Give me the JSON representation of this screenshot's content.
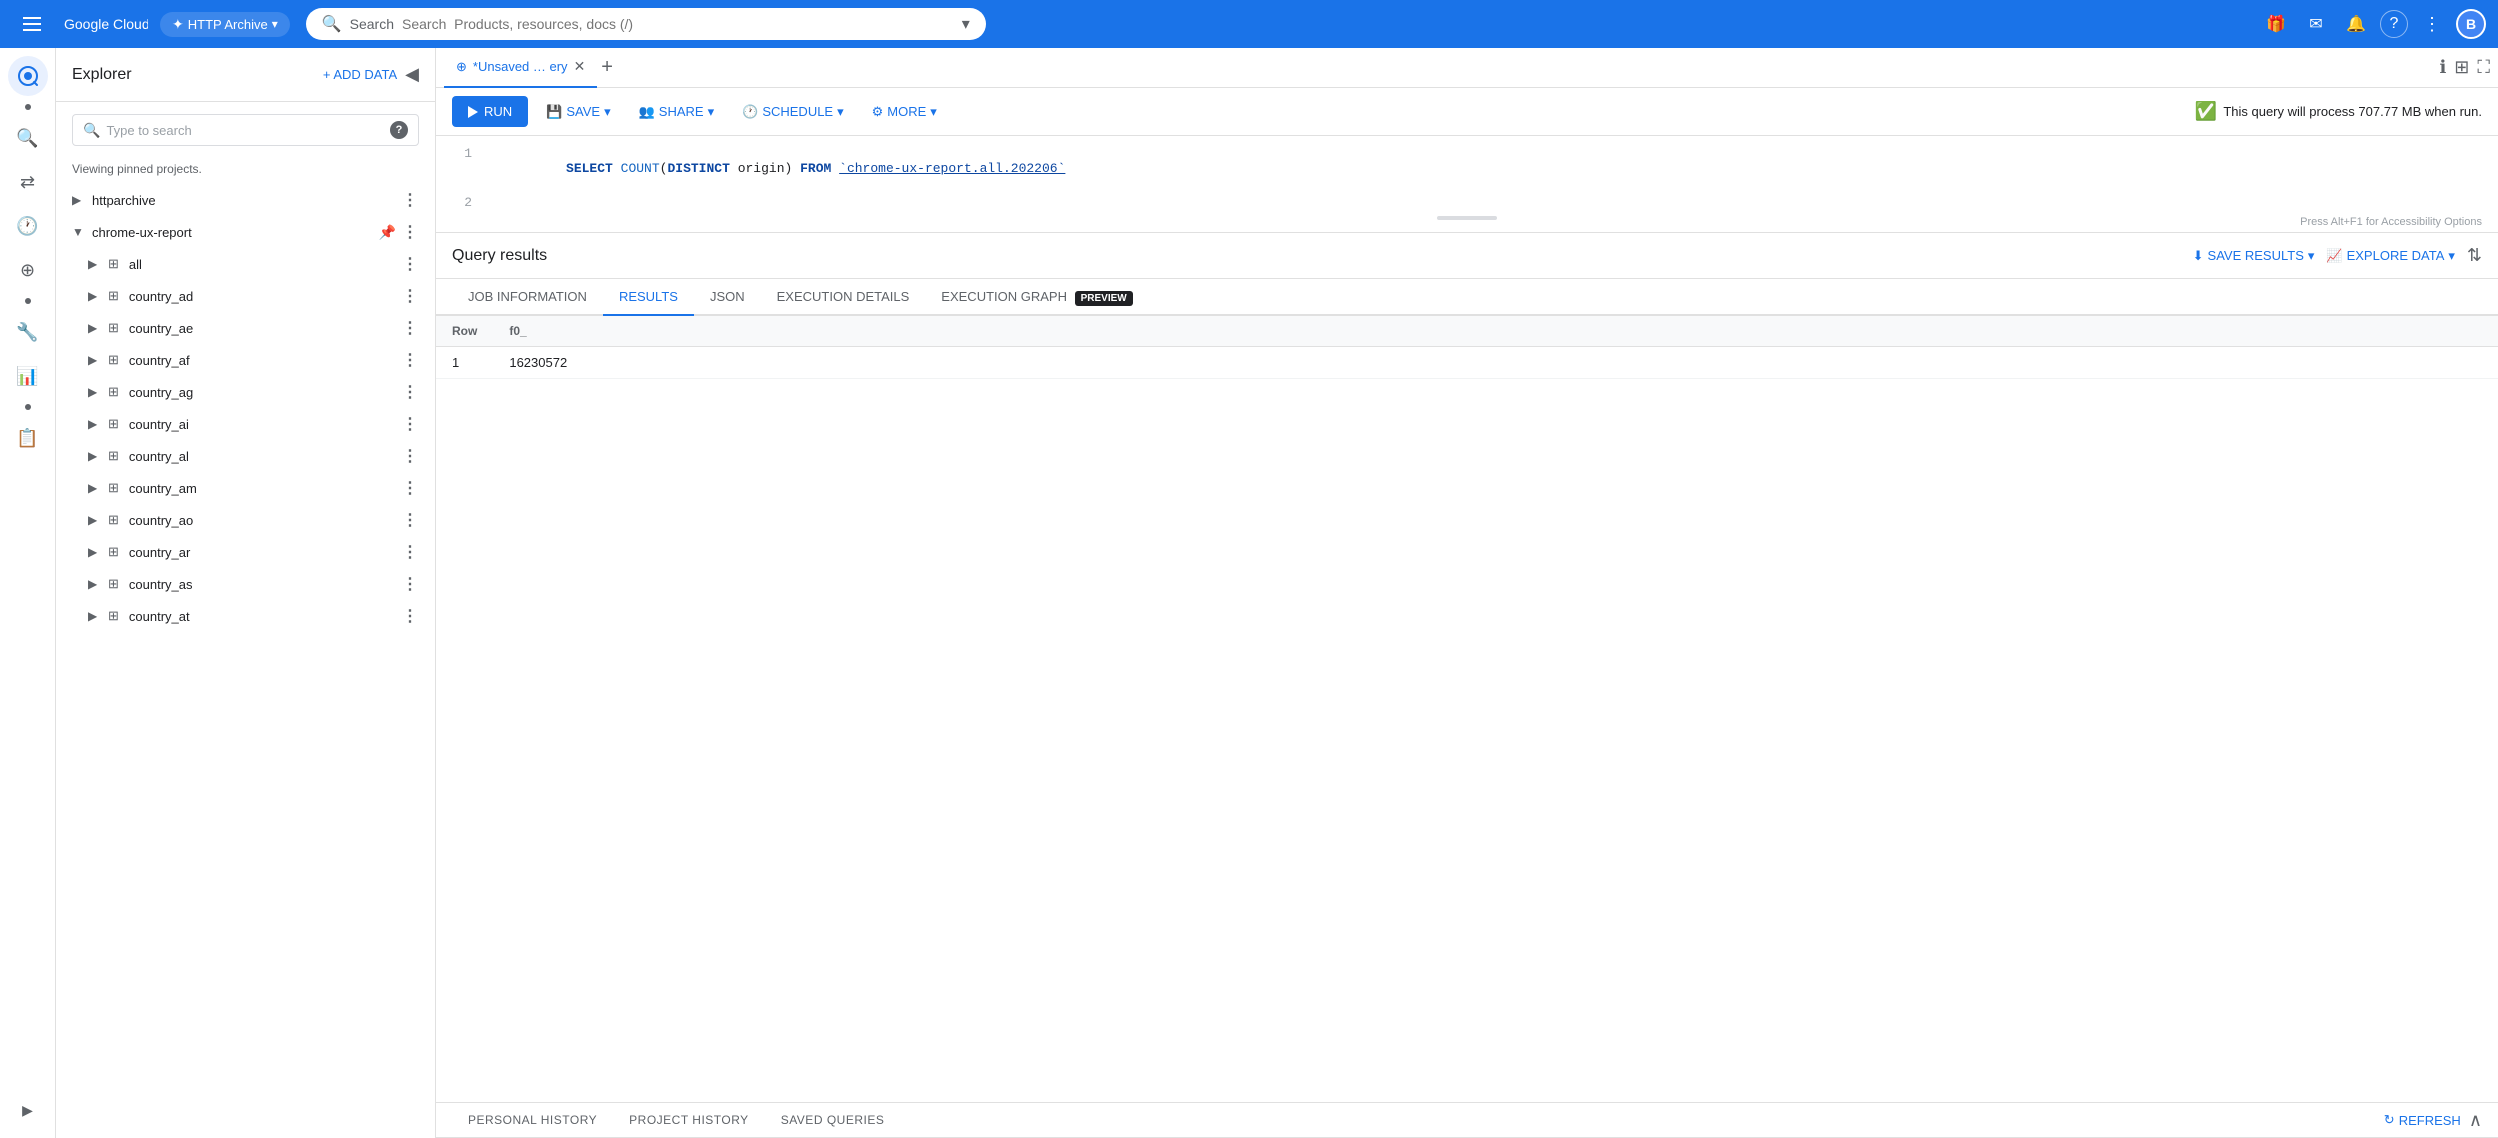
{
  "topbar": {
    "menu_icon": "☰",
    "logo_text": "Google Cloud",
    "project_name": "HTTP Archive",
    "search_placeholder": "Search  Products, resources, docs (/)",
    "gifts_icon": "🎁",
    "email_icon": "✉",
    "bell_icon": "🔔",
    "help_icon": "?",
    "more_icon": "⋮",
    "avatar_text": "B"
  },
  "explorer": {
    "title": "Explorer",
    "add_data_label": "+ ADD DATA",
    "collapse_icon": "◀",
    "search_placeholder": "Type to search",
    "pinned_label": "Viewing pinned projects.",
    "tree": [
      {
        "id": "httparchive",
        "label": "httparchive",
        "expanded": false,
        "pinned": false,
        "level": 0
      },
      {
        "id": "chrome-ux-report",
        "label": "chrome-ux-report",
        "expanded": true,
        "pinned": true,
        "level": 0
      },
      {
        "id": "all",
        "label": "all",
        "expanded": false,
        "pinned": false,
        "level": 1
      },
      {
        "id": "country_ad",
        "label": "country_ad",
        "expanded": false,
        "pinned": false,
        "level": 1
      },
      {
        "id": "country_ae",
        "label": "country_ae",
        "expanded": false,
        "pinned": false,
        "level": 1
      },
      {
        "id": "country_af",
        "label": "country_af",
        "expanded": false,
        "pinned": false,
        "level": 1
      },
      {
        "id": "country_ag",
        "label": "country_ag",
        "expanded": false,
        "pinned": false,
        "level": 1
      },
      {
        "id": "country_ai",
        "label": "country_ai",
        "expanded": false,
        "pinned": false,
        "level": 1
      },
      {
        "id": "country_al",
        "label": "country_al",
        "expanded": false,
        "pinned": false,
        "level": 1
      },
      {
        "id": "country_am",
        "label": "country_am",
        "expanded": false,
        "pinned": false,
        "level": 1
      },
      {
        "id": "country_ao",
        "label": "country_ao",
        "expanded": false,
        "pinned": false,
        "level": 1
      },
      {
        "id": "country_ar",
        "label": "country_ar",
        "expanded": false,
        "pinned": false,
        "level": 1
      },
      {
        "id": "country_as",
        "label": "country_as",
        "expanded": false,
        "pinned": false,
        "level": 1
      },
      {
        "id": "country_at",
        "label": "country_at",
        "expanded": false,
        "pinned": false,
        "level": 1
      }
    ]
  },
  "query_tab": {
    "label": "*Unsaved … ery",
    "close_icon": "✕",
    "add_icon": "+"
  },
  "toolbar": {
    "run_label": "RUN",
    "save_label": "SAVE",
    "share_label": "SHARE",
    "schedule_label": "SCHEDULE",
    "more_label": "MORE",
    "query_info": "This query will process 707.77 MB when run."
  },
  "editor": {
    "line1": "SELECT COUNT(DISTINCT origin) FROM `chrome-ux-report.all.202206`",
    "line2": "",
    "hint": "Press Alt+F1 for Accessibility Options"
  },
  "results": {
    "title": "Query results",
    "save_results_label": "SAVE RESULTS",
    "explore_data_label": "EXPLORE DATA",
    "tabs": [
      {
        "id": "job-info",
        "label": "JOB INFORMATION",
        "active": false
      },
      {
        "id": "results",
        "label": "RESULTS",
        "active": true
      },
      {
        "id": "json",
        "label": "JSON",
        "active": false
      },
      {
        "id": "execution-details",
        "label": "EXECUTION DETAILS",
        "active": false
      },
      {
        "id": "execution-graph",
        "label": "EXECUTION GRAPH",
        "active": false,
        "badge": "PREVIEW"
      }
    ],
    "table": {
      "columns": [
        "Row",
        "f0_"
      ],
      "rows": [
        {
          "row": "1",
          "f0_": "16230572"
        }
      ]
    }
  },
  "bottom_panel": {
    "tabs": [
      {
        "id": "personal-history",
        "label": "PERSONAL HISTORY"
      },
      {
        "id": "project-history",
        "label": "PROJECT HISTORY"
      },
      {
        "id": "saved-queries",
        "label": "SAVED QUERIES"
      }
    ],
    "refresh_label": "REFRESH",
    "collapse_icon": "∧"
  },
  "icons": {
    "search": "🔍",
    "pin": "📌",
    "more_vert": "⋮",
    "table": "⊞",
    "chevron_right": "▶",
    "chevron_down": "▼",
    "play": "▶",
    "save": "💾",
    "share": "👥",
    "schedule": "🕐",
    "settings": "⚙",
    "download": "⬇",
    "chart": "📈",
    "info": "ℹ",
    "grid": "⊞",
    "fullscreen": "⛶",
    "refresh": "↻",
    "collapse": "∧"
  }
}
